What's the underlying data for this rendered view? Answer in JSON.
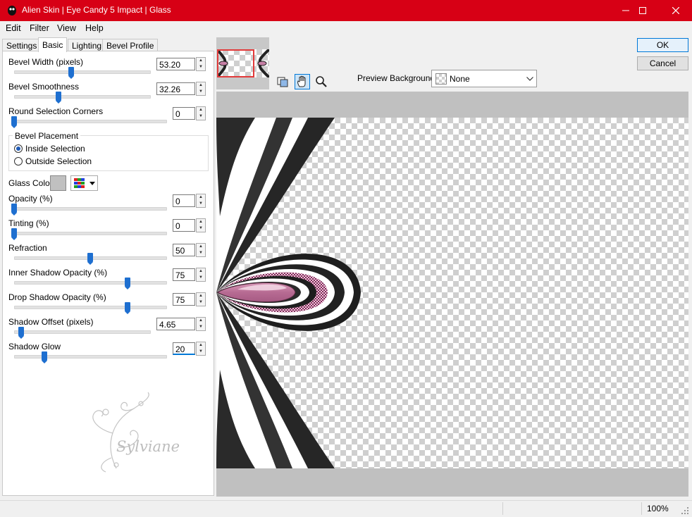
{
  "window": {
    "title": "Alien Skin | Eye Candy 5 Impact | Glass",
    "minimize_icon": "minimize-icon",
    "maximize_icon": "maximize-icon",
    "close_icon": "close-icon"
  },
  "menu": [
    "Edit",
    "Filter",
    "View",
    "Help"
  ],
  "tabs": [
    "Settings",
    "Basic",
    "Lighting",
    "Bevel Profile"
  ],
  "active_tab": "Basic",
  "controls": {
    "bevel_width": {
      "label": "Bevel Width (pixels)",
      "value": "53.20",
      "level": 0.42
    },
    "bevel_smoothness": {
      "label": "Bevel Smoothness",
      "value": "32.26",
      "level": 0.33
    },
    "round_corners": {
      "label": "Round Selection Corners",
      "value": "0",
      "level": 0.0
    },
    "bevel_placement": {
      "label": "Bevel Placement",
      "inside": "Inside Selection",
      "outside": "Outside Selection",
      "selected": "inside"
    },
    "glass_color": {
      "label": "Glass Color",
      "swatch": "#c0c0c0"
    },
    "opacity": {
      "label": "Opacity (%)",
      "value": "0",
      "level": 0.0
    },
    "tinting": {
      "label": "Tinting (%)",
      "value": "0",
      "level": 0.0
    },
    "refraction": {
      "label": "Refraction",
      "value": "50",
      "level": 0.5
    },
    "inner_shadow": {
      "label": "Inner Shadow Opacity (%)",
      "value": "75",
      "level": 0.75
    },
    "drop_shadow": {
      "label": "Drop Shadow Opacity (%)",
      "value": "75",
      "level": 0.75
    },
    "shadow_offset": {
      "label": "Shadow Offset (pixels)",
      "value": "4.65",
      "level": 0.05
    },
    "shadow_glow": {
      "label": "Shadow Glow",
      "value": "20",
      "level": 0.2
    }
  },
  "buttons": {
    "ok": "OK",
    "cancel": "Cancel"
  },
  "preview_background": {
    "label": "Preview Background:",
    "value": "None"
  },
  "watermark": "Sylviane",
  "status": {
    "zoom": "100%"
  },
  "colors": {
    "titlebar": "#d70015",
    "accent": "#1e6fd0",
    "glass": "#c77fa6"
  }
}
